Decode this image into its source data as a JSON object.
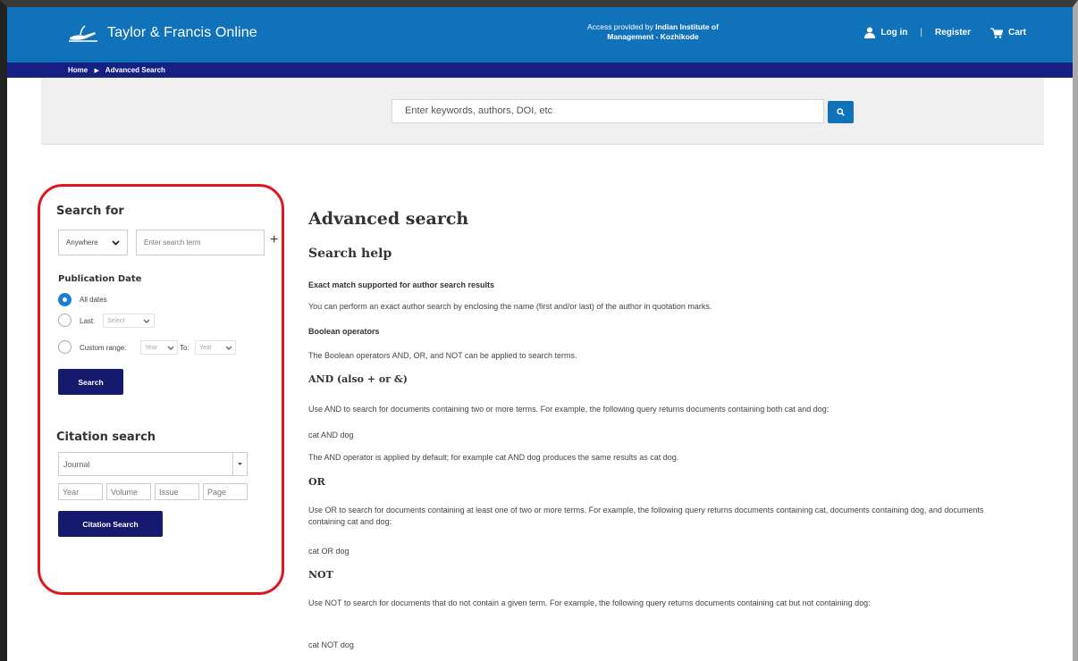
{
  "header": {
    "brand": "Taylor & Francis Online",
    "access_line1": "Access provided by",
    "access_org_line1": "Indian Institute of",
    "access_org_line2": "Management - Kozhikode",
    "login": "Log in",
    "separator": "|",
    "register": "Register",
    "cart": "Cart",
    "color": "#1072b8"
  },
  "breadcrumb": {
    "home": "Home",
    "current": "Advanced Search",
    "color": "#162083"
  },
  "search": {
    "placeholder": "Enter keywords, authors, DOI, etc"
  },
  "sidebar": {
    "search_for_title": "Search for",
    "field_select": "Anywhere",
    "term_placeholder": "Enter search term",
    "add": "+",
    "pub_date_title": "Publication Date",
    "all_dates": "All dates",
    "last_label": "Last:",
    "last_select": "Select",
    "custom_label": "Custom range:",
    "from_year": "Year",
    "to_label": "To:",
    "to_year": "Year",
    "search_button": "Search",
    "citation_title": "Citation search",
    "journal_placeholder": "Journal",
    "year_placeholder": "Year",
    "volume_placeholder": "Volume",
    "issue_placeholder": "Issue",
    "page_placeholder": "Page",
    "citation_button": "Citation Search",
    "highlight_color": "#e0161e"
  },
  "main": {
    "title": "Advanced search",
    "help_title": "Search help",
    "exact_heading": "Exact match supported for author search results",
    "exact_text": "You can perform an exact author search by enclosing the name (first and/or last) of the author in quotation marks.",
    "boolean_heading": "Boolean operators",
    "boolean_text": "The Boolean operators AND, OR, and NOT can be applied to search terms.",
    "and_heading": "AND (also + or &)",
    "and_text": "Use AND to search for documents containing two or more terms. For example, the following query returns documents containing both cat and dog:",
    "and_example": "cat AND dog",
    "and_default": "The AND operator is applied by default; for example cat AND dog produces the same results as cat dog.",
    "or_heading": "OR",
    "or_text": "Use OR to search for documents containing at least one of two or more terms. For example, the following query returns documents containing cat, documents containing dog, and documents containing cat and dog:",
    "or_example": "cat OR dog",
    "not_heading": "NOT",
    "not_text": "Use NOT to search for documents that do not contain a given term. For example, the following query returns documents containing cat but not containing dog:",
    "not_example": "cat NOT dog"
  }
}
